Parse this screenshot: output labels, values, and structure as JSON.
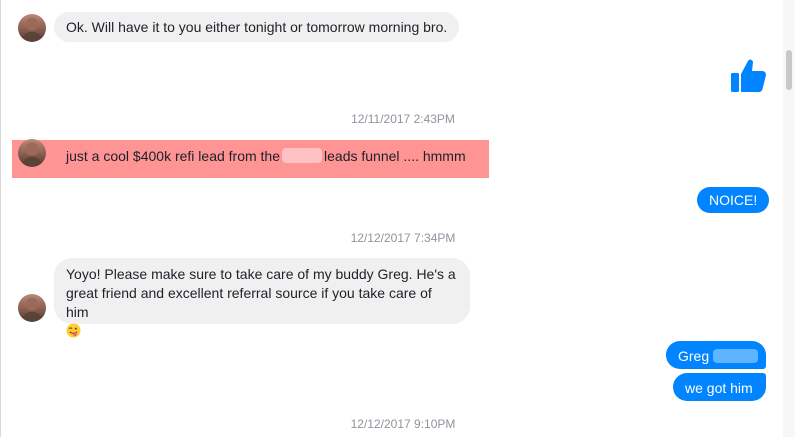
{
  "messages": {
    "m1": {
      "text": "Ok. Will have it to you either tonight or tomorrow morning bro."
    },
    "ts1": "12/11/2017 2:43PM",
    "m2": {
      "before": "just a cool $400k refi lead from the",
      "after": "leads funnel .... hmmm"
    },
    "m3": {
      "text": "NOICE!"
    },
    "ts2": "12/12/2017 7:34PM",
    "m4": {
      "line1": "Yoyo! Please make sure to take care of my buddy Greg. He's a",
      "line2": "great friend and excellent referral source if you take care of him"
    },
    "m5": {
      "text": "Greg"
    },
    "m6": {
      "text": "we got him"
    },
    "ts3": "12/12/2017 9:10PM"
  },
  "icons": {
    "like": "thumbs-up-icon",
    "emoji": "winking-tongue-emoji-icon"
  },
  "colors": {
    "outgoing_bubble": "#0084ff",
    "incoming_bubble": "#f1f0f0",
    "highlight": "#ff9494",
    "timestamp": "#90949c"
  }
}
